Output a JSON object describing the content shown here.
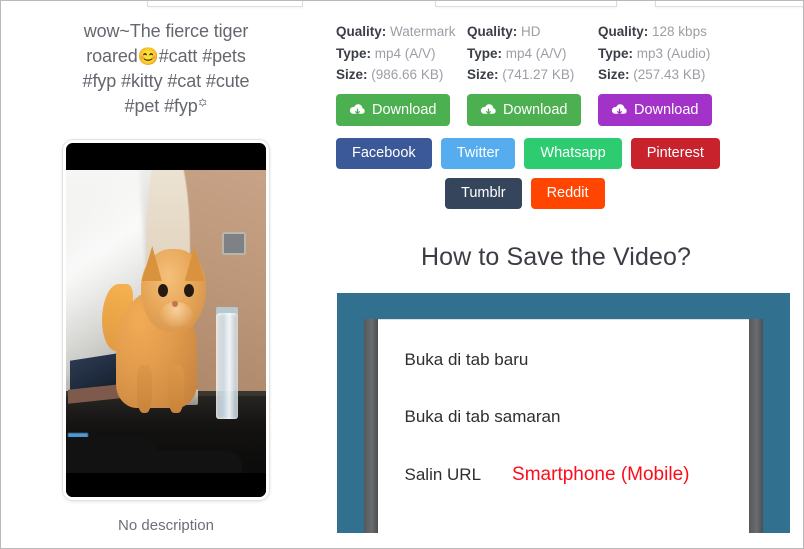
{
  "cards_peeking": [
    {
      "name": "card-stub-left"
    },
    {
      "name": "card-stub-middle"
    },
    {
      "name": "card-stub-right"
    }
  ],
  "video": {
    "title": "wow~The fierce tiger roared😊#catt #pets #fyp #kitty #cat #cute #pet #fyp꙳",
    "title_line1": "wow~The fierce tiger",
    "title_line2_pre": "roared",
    "title_emoji": "😊",
    "title_line2_post": "#catt #pets",
    "title_line3": "#fyp #kitty #cat #cute",
    "title_line4": "#pet #fyp꙳",
    "caption": "No description",
    "thumbnail_alt": "orange-tabby-cat-on-desk"
  },
  "download_options": [
    {
      "quality_label": "Quality:",
      "quality_value": "Watermark",
      "type_label": "Type:",
      "type_value": "mp4 (A/V)",
      "size_label": "Size:",
      "size_value": "(986.66 KB)",
      "button_label": "Download",
      "button_color": "#4caf50",
      "icon": "cloud-download-icon"
    },
    {
      "quality_label": "Quality:",
      "quality_value": "HD",
      "type_label": "Type:",
      "type_value": "mp4 (A/V)",
      "size_label": "Size:",
      "size_value": "(741.27 KB)",
      "button_label": "Download",
      "button_color": "#4caf50",
      "icon": "cloud-download-icon"
    },
    {
      "quality_label": "Quality:",
      "quality_value": "128 kbps",
      "type_label": "Type:",
      "type_value": "mp3 (Audio)",
      "size_label": "Size:",
      "size_value": "(257.43 KB)",
      "button_label": "Download",
      "button_color": "#a333c8",
      "icon": "cloud-download-icon"
    }
  ],
  "share": {
    "row1": [
      {
        "label": "Facebook",
        "color": "#3b5998"
      },
      {
        "label": "Twitter",
        "color": "#55acee"
      },
      {
        "label": "Whatsapp",
        "color": "#2ecc71"
      },
      {
        "label": "Pinterest",
        "color": "#c8232c"
      }
    ],
    "row2": [
      {
        "label": "Tumblr",
        "color": "#35465c"
      },
      {
        "label": "Reddit",
        "color": "#ff4500"
      }
    ]
  },
  "howto": {
    "heading": "How to Save the Video?",
    "menu_items": [
      "Buka di tab baru",
      "Buka di tab samaran",
      "Salin URL"
    ],
    "item_new_tab": "Buka di tab baru",
    "item_incognito": "Buka di tab samaran",
    "item_copy_url": "Salin URL",
    "device_tag": "Smartphone (Mobile)",
    "device_tag_color": "#fc0d1b",
    "frame_color": "#31708f"
  }
}
